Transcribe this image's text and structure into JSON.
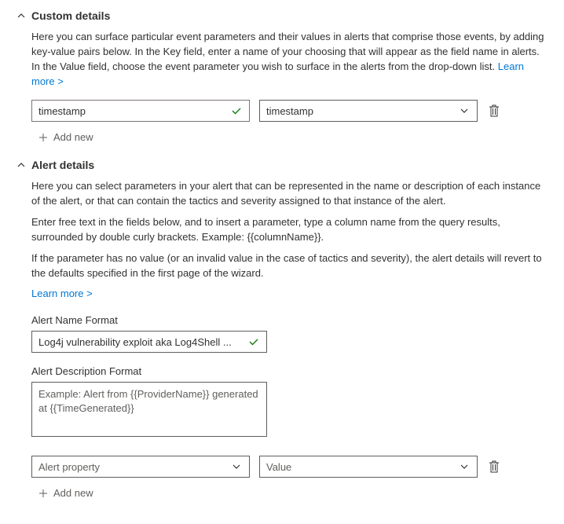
{
  "custom_details": {
    "title": "Custom details",
    "description": "Here you can surface particular event parameters and their values in alerts that comprise those events, by adding key-value pairs below. In the Key field, enter a name of your choosing that will appear as the field name in alerts. In the Value field, choose the event parameter you wish to surface in the alerts from the drop-down list.",
    "learn_more": "Learn more >",
    "key_value": "timestamp",
    "value_value": "timestamp",
    "add_new": "Add new"
  },
  "alert_details": {
    "title": "Alert details",
    "description1": "Here you can select parameters in your alert that can be represented in the name or description of each instance of the alert, or that can contain the tactics and severity assigned to that instance of the alert.",
    "description2": "Enter free text in the fields below, and to insert a parameter, type a column name from the query results, surrounded by double curly brackets. Example: {{columnName}}.",
    "description3": "If the parameter has no value (or an invalid value in the case of tactics and severity), the alert details will revert to the defaults specified in the first page of the wizard.",
    "learn_more": "Learn more >",
    "alert_name_label": "Alert Name Format",
    "alert_name_value": "Log4j vulnerability exploit aka Log4Shell ...",
    "alert_desc_label": "Alert Description Format",
    "alert_desc_placeholder": "Example: Alert from {{ProviderName}} generated at {{TimeGenerated}}",
    "property_placeholder": "Alert property",
    "value_placeholder": "Value",
    "add_new": "Add new"
  }
}
